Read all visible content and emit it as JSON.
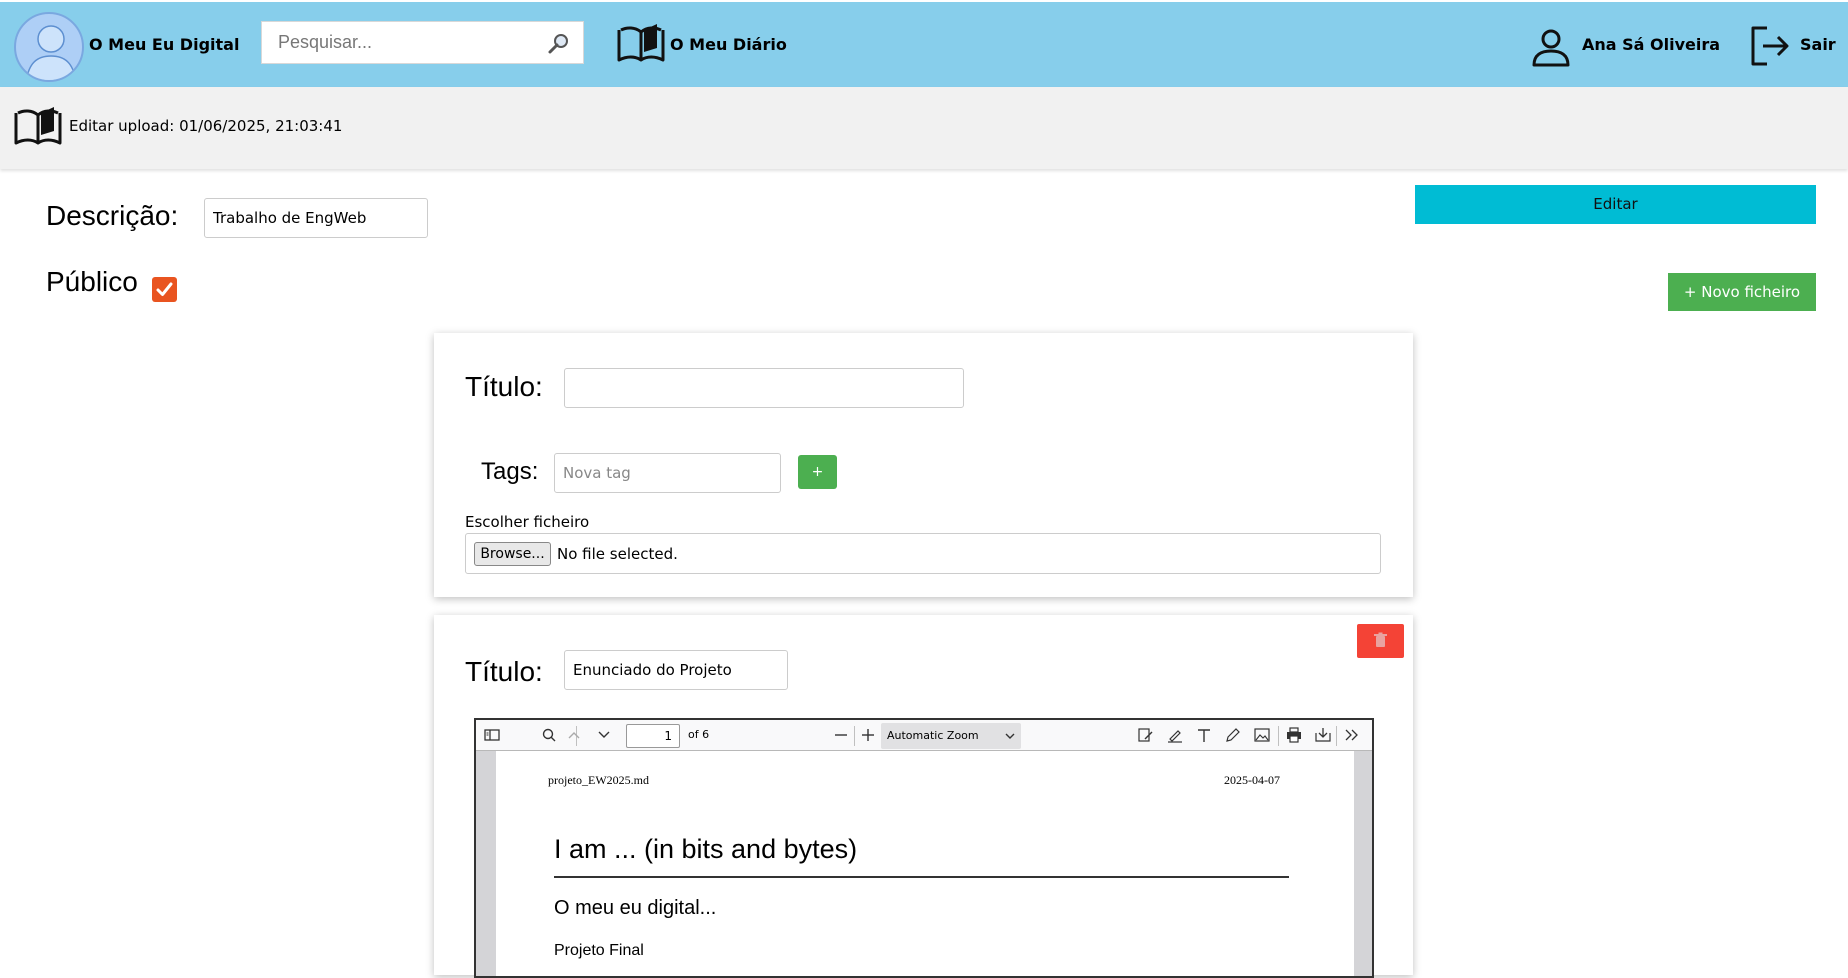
{
  "header": {
    "brand": "O Meu Eu Digital",
    "search_placeholder": "Pesquisar...",
    "diary_link": "O Meu Diário",
    "user_name": "Ana Sá Oliveira",
    "logout": "Sair"
  },
  "subheader": {
    "text": "Editar upload: 01/06/2025, 21:03:41"
  },
  "form": {
    "description_label": "Descrição:",
    "description_value": "Trabalho de EngWeb",
    "edit_button": "Editar",
    "public_label": "Público",
    "public_checked": true,
    "new_file_button": "+ Novo ficheiro"
  },
  "new_file_card": {
    "title_label": "Título:",
    "title_value": "",
    "tags_label": "Tags:",
    "tag_placeholder": "Nova tag",
    "tag_add": "+",
    "file_label": "Escolher ficheiro",
    "browse": "Browse...",
    "no_file": "No file selected."
  },
  "existing_file_card": {
    "title_label": "Título:",
    "title_value": "Enunciado do Projeto",
    "pdf": {
      "page_number": "1",
      "page_of": "of 6",
      "zoom": "Automatic Zoom",
      "header_left": "projeto_EW2025.md",
      "header_right": "2025-04-07",
      "heading1": "I am ... (in bits and bytes)",
      "heading2": "O meu eu digital...",
      "heading3": "Projeto Final"
    }
  },
  "colors": {
    "topbar": "#87ceeb",
    "edit": "#00bcd4",
    "green": "#4caf50",
    "delete": "#f44336",
    "checkbox": "#e95420"
  }
}
